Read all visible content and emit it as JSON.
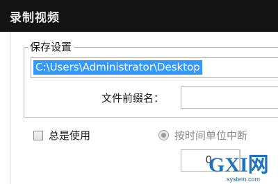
{
  "window": {
    "title": "录制视频"
  },
  "save_settings": {
    "legend": "保存设置",
    "path_value": "C:\\Users\\Administrator\\Desktop",
    "suffix_label": "文件前缀名：",
    "suffix_value": ""
  },
  "options": {
    "always_use_label": "总是使用",
    "always_use_checked": false,
    "stop_by_time_label": "按时间单位中断",
    "stop_by_time_selected": true,
    "stop_by_time_enabled": false,
    "time_value": "0"
  },
  "watermark": {
    "brand": "GXI网",
    "site": "system.com"
  },
  "colors": {
    "titlebar": "#141414",
    "selection": "#3399ff",
    "watermark_blue": "#1e73be"
  }
}
